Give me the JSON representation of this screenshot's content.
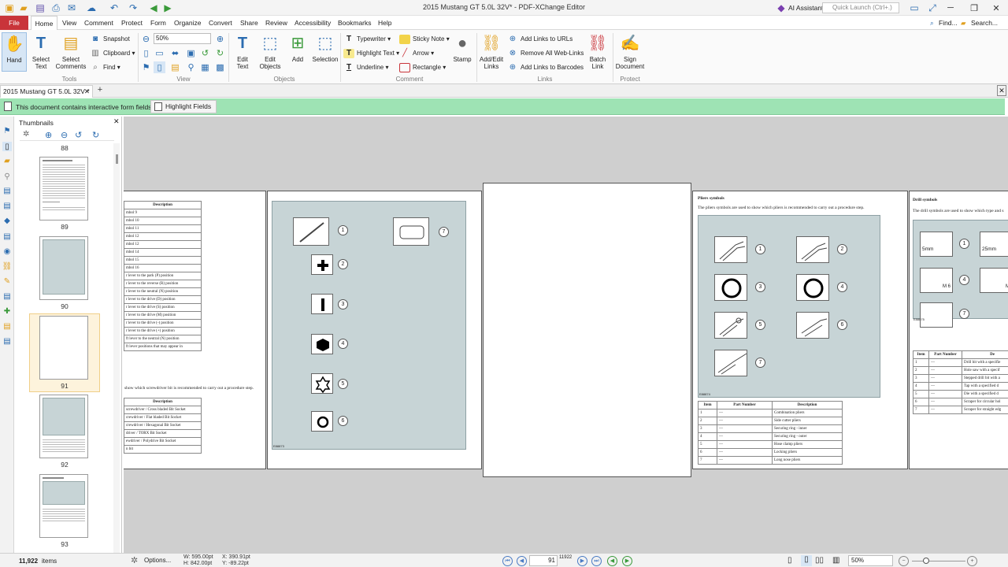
{
  "window": {
    "title": "2015 Mustang GT 5.0L 32V* - PDF-XChange Editor",
    "ai_assistant": "AI Assistant",
    "quick_launch_placeholder": "Quick Launch (Ctrl+.)"
  },
  "menu": {
    "items": [
      "File",
      "Home",
      "View",
      "Comment",
      "Protect",
      "Form",
      "Organize",
      "Convert",
      "Share",
      "Review",
      "Accessibility",
      "Bookmarks",
      "Help"
    ],
    "find": "Find...",
    "search": "Search..."
  },
  "ribbon": {
    "tools": {
      "hand": "Hand",
      "select_text": "Select\nText",
      "select_comments": "Select\nComments",
      "snapshot": "Snapshot",
      "clipboard": "Clipboard",
      "find": "Find",
      "label": "Tools"
    },
    "view": {
      "zoom": "50%",
      "label": "View"
    },
    "objects": {
      "edit_text": "Edit\nText",
      "edit_objects": "Edit\nObjects",
      "add": "Add",
      "selection": "Selection",
      "label": "Objects"
    },
    "comment": {
      "typewriter": "Typewriter",
      "highlight_text": "Highlight Text",
      "underline": "Underline",
      "sticky_note": "Sticky Note",
      "arrow": "Arrow",
      "rectangle": "Rectangle",
      "stamp": "Stamp",
      "label": "Comment"
    },
    "links": {
      "add_edit_links": "Add/Edit\nLinks",
      "add_links_to_urls": "Add Links to URLs",
      "remove_all_web_links": "Remove All Web-Links",
      "add_links_to_barcodes": "Add Links to Barcodes",
      "batch_link": "Batch\nLink",
      "label": "Links"
    },
    "protect": {
      "sign_document": "Sign\nDocument",
      "label": "Protect"
    }
  },
  "tabs": {
    "document": "2015 Mustang GT 5.0L 32V *"
  },
  "infobar": {
    "message": "This document contains interactive form fields.",
    "highlight_fields": "Highlight Fields"
  },
  "thumbnails": {
    "title": "Thumbnails",
    "pages": [
      "88",
      "89",
      "90",
      "91",
      "92",
      "93"
    ],
    "selected": "91",
    "items_count": "11,922",
    "items_label": "items"
  },
  "pages": {
    "left": {
      "table1_header": "Description",
      "table1_rows": [
        "mbol 9",
        "mbol 10",
        "mbol 11",
        "mbol 12",
        "mbol 12",
        "mbol 14",
        "mbol 15",
        "mbol 16",
        "r lever to the park (P) position",
        "r lever to the reverse (R) position",
        "r lever to the neutral (N) position",
        "r lever to the drive (D) position",
        "r lever to the drive (S) position",
        "r lever to the drive (M) position",
        "r lever to the drive (-) position",
        "r lever to the drive (+) position",
        "ft lever to the neutral (N) position",
        "ft lever positions that may appear in"
      ],
      "caption": "show which screwdriver bit is recommended to carry out a procedure step.",
      "table2_header": "Description",
      "table2_rows": [
        "screwdriver / Cross bladed Bit Socket",
        "crewdriver / Flat bladed Bit Socket",
        "crewdriver / Hexagonal Bit Socket",
        "driver / TORX Bit Socket",
        "ewdriver / Polydrive Bit Socket",
        "n bit"
      ]
    },
    "bits": {
      "numbers": [
        "1",
        "2",
        "3",
        "4",
        "5",
        "6",
        "7"
      ],
      "code": "E88873"
    },
    "pliers": {
      "title": "Pliers symbols",
      "intro": "The pliers symbols are used to show which pliers is recommended to carry out a procedure step.",
      "numbers": [
        "1",
        "2",
        "3",
        "4",
        "5",
        "6",
        "7"
      ],
      "code": "E88874",
      "headers": [
        "Item",
        "Part Number",
        "Description"
      ],
      "rows": [
        [
          "1",
          "—",
          "Combination pliers"
        ],
        [
          "2",
          "—",
          "Side cutter pliers"
        ],
        [
          "3",
          "—",
          "Securing ring - inner"
        ],
        [
          "4",
          "—",
          "Securing ring - outer"
        ],
        [
          "5",
          "—",
          "Hose clamp pliers"
        ],
        [
          "6",
          "—",
          "Locking pliers"
        ],
        [
          "7",
          "—",
          "Long nose pliers"
        ]
      ]
    },
    "drill": {
      "title": "Drill symbols",
      "intro": "The drill symbols are used to show which type and s",
      "labels": [
        "5mm",
        "25mm",
        "M 6",
        "M"
      ],
      "numbers": [
        "1",
        "4",
        "7"
      ],
      "code": "E88875",
      "headers": [
        "Item",
        "Part Number",
        "De"
      ],
      "rows": [
        [
          "1",
          "—",
          "Drill bit with a specifie"
        ],
        [
          "2",
          "—",
          "Hole saw with a specif"
        ],
        [
          "3",
          "—",
          "Stepped drill bit with a"
        ],
        [
          "4",
          "—",
          "Tap with a specified d"
        ],
        [
          "5",
          "—",
          "Die with a specified d"
        ],
        [
          "6",
          "—",
          "Scraper for circular hol"
        ],
        [
          "7",
          "—",
          "Scraper for straight edg"
        ]
      ]
    }
  },
  "statusbar": {
    "options": "Options...",
    "w": "W: 595.00pt",
    "h": "H: 842.00pt",
    "x": "X: 390.91pt",
    "y": "Y: -89.22pt",
    "page_current": "91",
    "page_total": "11922",
    "zoom": "50%"
  }
}
